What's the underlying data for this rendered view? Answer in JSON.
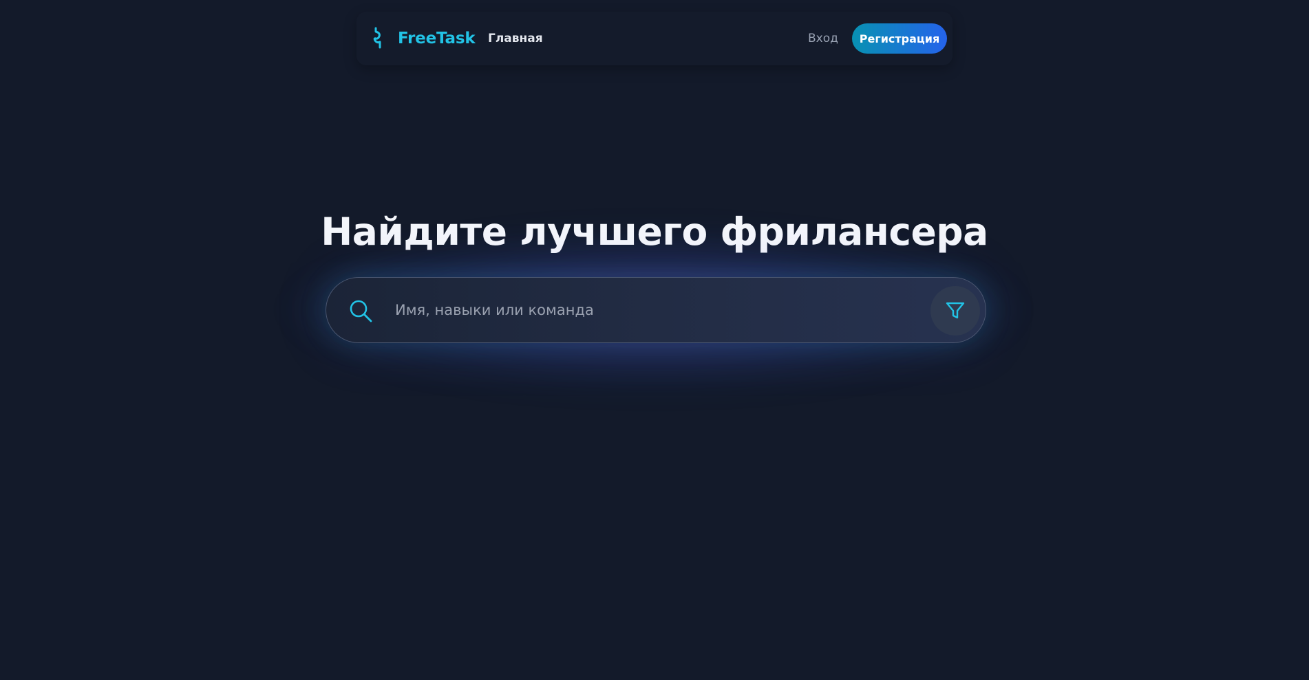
{
  "header": {
    "brand_name": "FreeTask",
    "nav_home": "Главная",
    "nav_login": "Вход",
    "register_label": "Регистрация"
  },
  "hero": {
    "title": "Найдите лучшего фрилансера",
    "search_placeholder": "Имя, навыки или команда",
    "search_value": ""
  },
  "icons": {
    "logo": "dollar-squiggle-icon",
    "search": "search-icon",
    "filter": "filter-icon"
  },
  "colors": {
    "background": "#131a2a",
    "accent": "#22c3e6",
    "register_gradient_start": "#0891b2",
    "register_gradient_end": "#2563eb",
    "title": "#f4f6fb"
  }
}
